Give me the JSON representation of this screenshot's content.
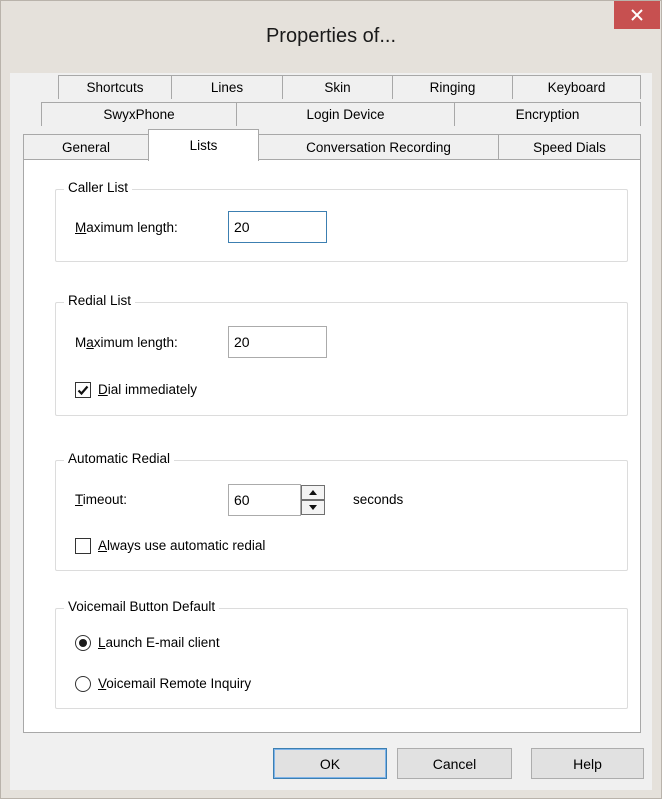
{
  "window": {
    "title": "Properties of..."
  },
  "tabs": {
    "row1": [
      "Shortcuts",
      "Lines",
      "Skin",
      "Ringing",
      "Keyboard"
    ],
    "row2": [
      "SwyxPhone",
      "Login Device",
      "Encryption"
    ],
    "row3": [
      "General",
      "Lists",
      "Conversation Recording",
      "Speed Dials"
    ],
    "active": "Lists"
  },
  "caller_list": {
    "title": "Caller List",
    "max_length_label": "aximum length:",
    "max_length_mnemonic": "M",
    "max_length_value": "20"
  },
  "redial_list": {
    "title": "Redial List",
    "max_length_label_pre": "M",
    "max_length_mnemonic": "a",
    "max_length_label_post": "ximum length:",
    "max_length_value": "20",
    "dial_immediately_mnemonic": "D",
    "dial_immediately_label": "ial immediately",
    "dial_immediately_checked": true
  },
  "automatic_redial": {
    "title": "Automatic Redial",
    "timeout_mnemonic": "T",
    "timeout_label": "imeout:",
    "timeout_value": "60",
    "seconds_label": "seconds",
    "always_mnemonic": "A",
    "always_label": "lways use automatic redial",
    "always_checked": false
  },
  "voicemail": {
    "title": "Voicemail Button Default",
    "launch_mnemonic": "L",
    "launch_label": "aunch E-mail client",
    "launch_selected": true,
    "remote_mnemonic": "V",
    "remote_label": "oicemail Remote Inquiry",
    "remote_selected": false
  },
  "buttons": {
    "ok": "OK",
    "cancel": "Cancel",
    "help": "Help"
  },
  "colors": {
    "close_button": "#c75050",
    "focus_border": "#3c7fb1"
  }
}
